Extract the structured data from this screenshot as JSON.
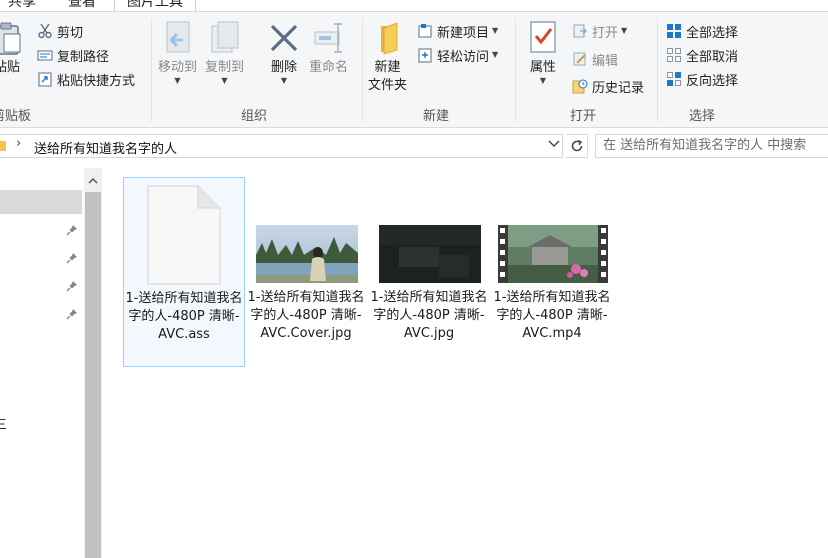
{
  "tabs": {
    "share": "共享",
    "view": "查看",
    "picture_tools": "图片工具"
  },
  "ribbon": {
    "clipboard": {
      "label": "剪贴板",
      "paste": "粘贴",
      "cut": "剪切",
      "copy_path": "复制路径",
      "paste_shortcut": "粘贴快捷方式"
    },
    "organize": {
      "label": "组织",
      "move_to": "移动到",
      "copy_to": "复制到",
      "delete": "删除",
      "rename": "重命名"
    },
    "new": {
      "label": "新建",
      "new_folder": "新建\n文件夹",
      "new_item": "新建项目",
      "easy_access": "轻松访问"
    },
    "open": {
      "label": "打开",
      "properties": "属性",
      "open": "打开",
      "edit": "编辑",
      "history": "历史记录"
    },
    "select": {
      "label": "选择",
      "select_all": "全部选择",
      "select_none": "全部取消",
      "invert": "反向选择"
    }
  },
  "address": {
    "path": "送给所有知道我名字的人",
    "search_placeholder": "在 送给所有知道我名字的人 中搜索"
  },
  "nav": {
    "partial_item": "三"
  },
  "files": [
    {
      "name": "1-送给所有知道我名字的人-480P 清晰-AVC.ass",
      "type": "document"
    },
    {
      "name": "1-送给所有知道我名字的人-480P 清晰-AVC.Cover.jpg",
      "type": "image"
    },
    {
      "name": "1-送给所有知道我名字的人-480P 清晰-AVC.jpg",
      "type": "image"
    },
    {
      "name": "1-送给所有知道我名字的人-480P 清晰-AVC.mp4",
      "type": "video"
    }
  ],
  "colors": {
    "ribbon_bg": "#f5f6f7",
    "selection_border": "#99d1ff",
    "selection_fill": "#f2f8fd",
    "accent_blue": "#1979ca",
    "folder_yellow": "#f3c44b",
    "properties_red": "#d9442b"
  }
}
